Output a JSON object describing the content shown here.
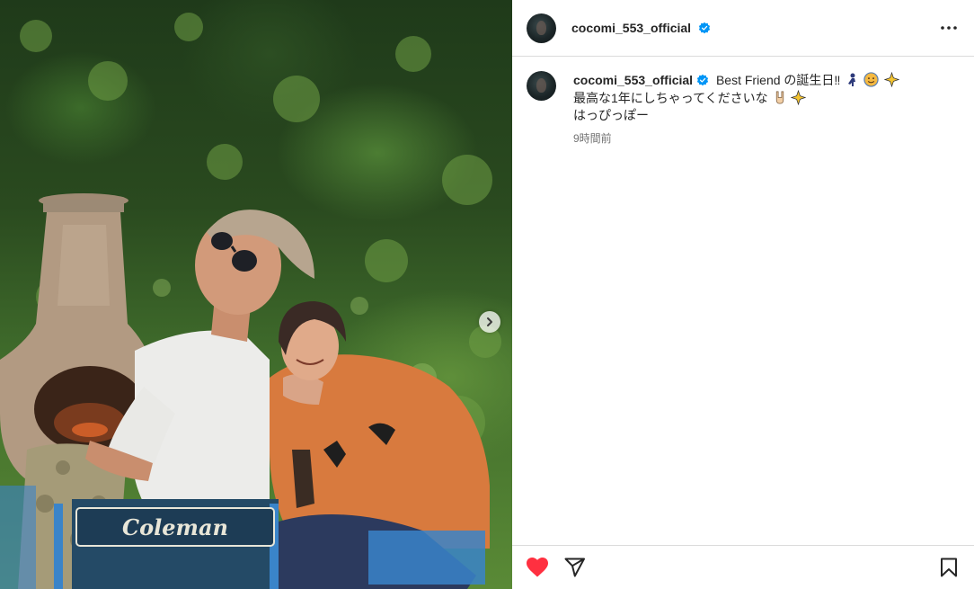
{
  "post": {
    "username": "cocomi_553_official",
    "caption_lines": [
      "Best Friend の誕生日‼",
      "最高な1年にしちゃってくださいな",
      "はっぴっぽー"
    ],
    "timestamp": "9時間前",
    "photo_text": "Coleman",
    "liked": true
  },
  "icons": {
    "verified": "verified-badge-icon",
    "more": "more-options-icon",
    "carousel_next": "chevron-right-icon",
    "like": "heart-filled-icon",
    "share": "paper-plane-icon",
    "save": "bookmark-icon",
    "caption_emoji_1": "runner-emoji-icon",
    "caption_emoji_2": "smiling-face-emoji-icon",
    "caption_emoji_3": "sparkles-emoji-icon",
    "caption_emoji_4": "rock-hand-emoji-icon",
    "caption_emoji_5": "sparkles-emoji-icon"
  },
  "colors": {
    "verified_blue": "#0095f6",
    "like_red": "#ff3040",
    "text_primary": "#262626",
    "text_secondary": "#737373",
    "border": "#dbdbdb"
  }
}
